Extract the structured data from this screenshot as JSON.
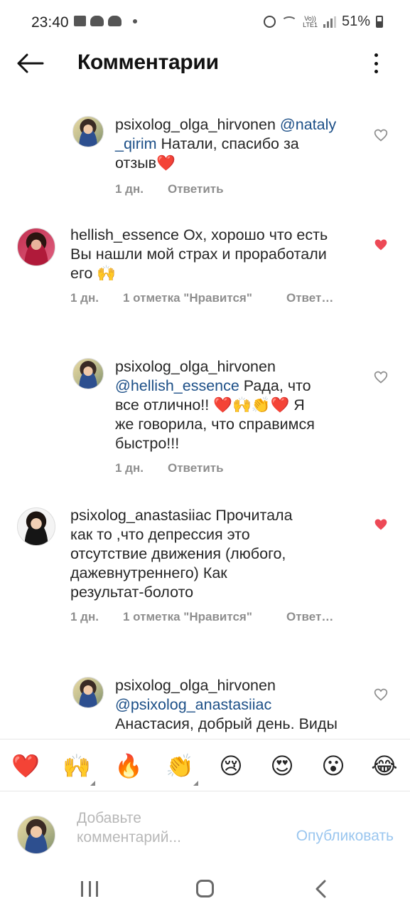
{
  "status_bar": {
    "time": "23:40",
    "battery": "51%",
    "volte": "Vo))",
    "network": "LTE1"
  },
  "header": {
    "title": "Комментарии"
  },
  "comments": [
    {
      "username": "psixolog_olga_hirvonen",
      "mention": "@nataly_qirim",
      "text_line1": "psixolog_olga_hirvonen ",
      "mention_part1": "@nataly",
      "mention_part2": "_qirim",
      "text": " Натали, спасибо за",
      "text2": "отзыв❤️",
      "time": "1 дн.",
      "reply": "Ответить",
      "liked": false
    },
    {
      "username": "hellish_essence",
      "line1": "hellish_essence Ох, хорошо что есть",
      "line2": "Вы нашли мой страх и проработали",
      "line3": "его 🙌",
      "time": "1 дн.",
      "likes": "1 отметка \"Нравится\"",
      "reply": "Ответ…",
      "liked": true
    },
    {
      "username": "psixolog_olga_hirvonen",
      "mention": "@hellish_essence",
      "text": " Рада, что",
      "line3": "все отлично!! ❤️🙌👏❤️ Я",
      "line4": "же говорила, что справимся",
      "line5": "быстро!!!",
      "time": "1 дн.",
      "reply": "Ответить",
      "liked": false
    },
    {
      "username": "psixolog_anastasiiac",
      "line1": "psixolog_anastasiiac Прочитала",
      "line2": "как то ,что депрессия это",
      "line3": "отсутствие движения (любого,",
      "line4": "дажевнутреннего) Как",
      "line5": "результат-болото",
      "time": "1 дн.",
      "likes": "1 отметка \"Нравится\"",
      "reply": "Ответ…",
      "liked": true
    },
    {
      "username": "psixolog_olga_hirvonen",
      "mention": "@psixolog_anastasiiac",
      "line3": "Анастасия, добрый день. Виды",
      "liked": false
    }
  ],
  "emoji_bar": [
    {
      "icon": "red-heart",
      "glyph": "❤️"
    },
    {
      "icon": "raising-hands",
      "glyph": "🙌"
    },
    {
      "icon": "fire",
      "glyph": "🔥"
    },
    {
      "icon": "clapping-hands",
      "glyph": "👏"
    },
    {
      "icon": "crying-face",
      "glyph": "😢"
    },
    {
      "icon": "heart-eyes",
      "glyph": "😍"
    },
    {
      "icon": "surprised-face",
      "glyph": "😮"
    },
    {
      "icon": "tears-of-joy",
      "glyph": "😂"
    }
  ],
  "composer": {
    "placeholder_line1": "Добавьте",
    "placeholder_line2": "комментарий...",
    "publish": "Опубликовать"
  },
  "colors": {
    "mention": "#1c4f87",
    "meta": "#8e8e8e",
    "like": "#ed4956",
    "publish": "#9ac6ef"
  }
}
